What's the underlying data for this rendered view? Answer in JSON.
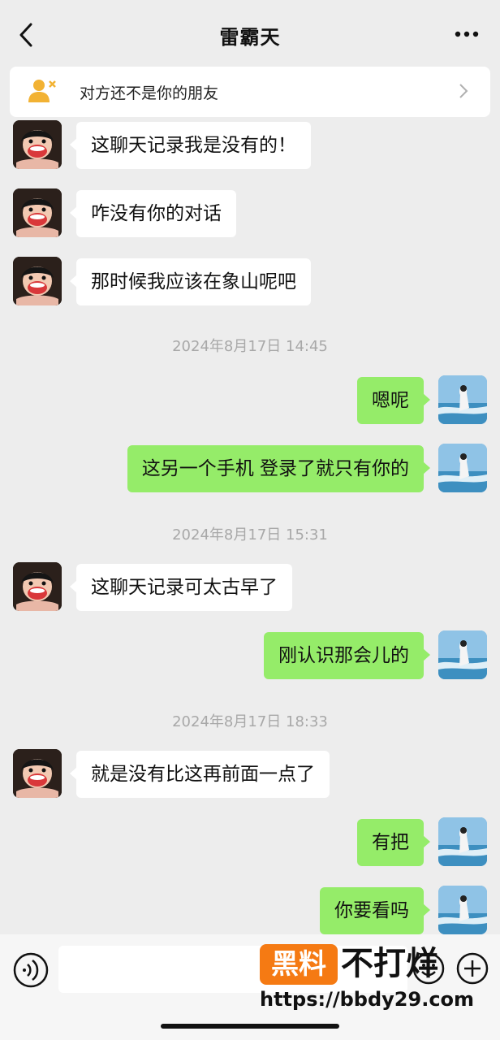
{
  "header": {
    "title": "雷霸天"
  },
  "notice": {
    "text": "对方还不是你的朋友"
  },
  "messages": [
    {
      "side": "in",
      "text": "这聊天记录我是没有的！"
    },
    {
      "side": "in",
      "text": "咋没有你的对话"
    },
    {
      "side": "in",
      "text": "那时候我应该在象山呢吧"
    },
    {
      "side": "out",
      "text": "嗯呢"
    },
    {
      "side": "out",
      "text": "这另一个手机 登录了就只有你的"
    },
    {
      "side": "in",
      "text": "这聊天记录可太古早了"
    },
    {
      "side": "out",
      "text": "刚认识那会儿的"
    },
    {
      "side": "in",
      "text": "就是没有比这再前面一点了"
    },
    {
      "side": "out",
      "text": "有把"
    },
    {
      "side": "out",
      "text": "你要看吗"
    }
  ],
  "timestamps": [
    "2024年8月17日 14:45",
    "2024年8月17日 15:31",
    "2024年8月17日 18:33"
  ],
  "watermark": {
    "badge": "黑料",
    "title": "不打烊",
    "url": "https://bbdy29.com"
  },
  "colors": {
    "background": "#ededed",
    "outgoing_bubble": "#95ec69",
    "incoming_bubble": "#ffffff",
    "watermark_orange": "#f57a13"
  }
}
